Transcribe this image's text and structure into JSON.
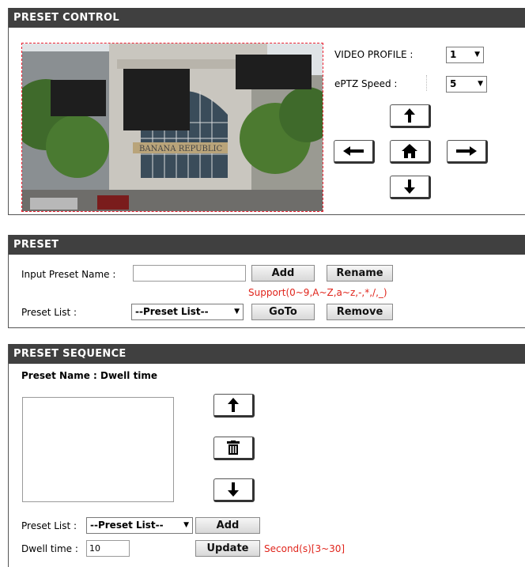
{
  "preset_control": {
    "title": "PRESET CONTROL",
    "video_profile_label": "VIDEO PROFILE :",
    "video_profile_value": "1",
    "eptz_speed_label": "ePTZ Speed :",
    "eptz_speed_value": "5",
    "camera_sign_text": "BANANA REPUBLIC",
    "buttons": [
      "up-arrow-icon",
      "left-arrow-icon",
      "home-icon",
      "right-arrow-icon",
      "down-arrow-icon"
    ]
  },
  "preset": {
    "title": "PRESET",
    "input_label": "Input Preset Name :",
    "input_value": "",
    "add_label": "Add",
    "rename_label": "Rename",
    "support_text": "Support(0~9,A~Z,a~z,-,*,/,_)",
    "list_label": "Preset List :",
    "list_value": "--Preset List--",
    "goto_label": "GoTo",
    "remove_label": "Remove"
  },
  "sequence": {
    "title": "PRESET SEQUENCE",
    "name_header": "Preset Name : Dwell time",
    "list_label": "Preset List :",
    "list_value": "--Preset List--",
    "add_label": "Add",
    "dwell_label": "Dwell time :",
    "dwell_value": "10",
    "update_label": "Update",
    "range_text": "Second(s)[3~30]"
  },
  "colors": {
    "header_bg": "#404040",
    "accent_red": "#e0241b"
  }
}
